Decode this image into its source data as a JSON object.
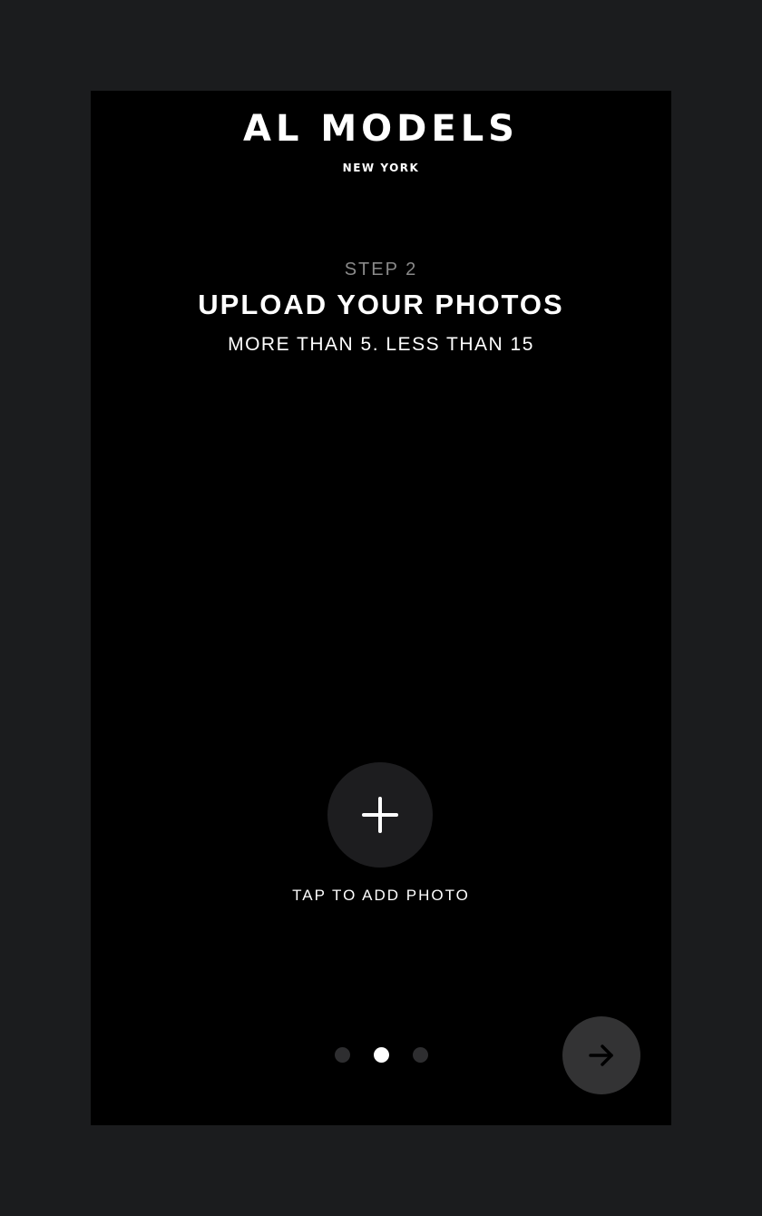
{
  "brand": {
    "name": "AL MODELS",
    "location": "NEW YORK"
  },
  "step": {
    "label": "STEP 2",
    "title": "UPLOAD YOUR PHOTOS",
    "subtitle": "MORE THAN 5. LESS THAN 15"
  },
  "add_photo": {
    "icon": "plus-icon",
    "label": "TAP TO ADD PHOTO"
  },
  "pager": {
    "total": 3,
    "active_index": 1
  },
  "next_button": {
    "icon": "arrow-right-icon"
  },
  "colors": {
    "page_background": "#1b1c1e",
    "screen_background": "#000000",
    "text_primary": "#ffffff",
    "text_muted": "#8a8a8a",
    "add_button_bg": "#1d1d1f",
    "next_button_bg": "#333334",
    "dot_inactive": "#2e2e30",
    "dot_active": "#ffffff"
  }
}
